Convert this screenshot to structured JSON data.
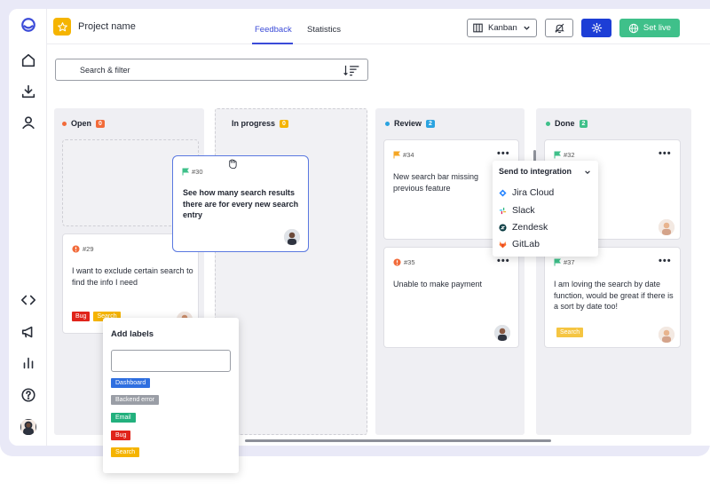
{
  "header": {
    "project_name": "Project name",
    "tabs": [
      {
        "label": "Feedback",
        "active": true
      },
      {
        "label": "Statistics",
        "active": false
      }
    ],
    "view_select": "Kanban",
    "set_live_label": "Set live"
  },
  "search": {
    "placeholder": "Search & filter"
  },
  "columns": [
    {
      "title": "Open",
      "count": "0",
      "dot_color": "#f26b3a",
      "count_color": "#f26b3a"
    },
    {
      "title": "In progress",
      "count": "0",
      "dot_color": "",
      "count_color": "#f5b400"
    },
    {
      "title": "Review",
      "count": "2",
      "dot_color": "#2aa3e0",
      "count_color": "#2aa3e0"
    },
    {
      "title": "Done",
      "count": "2",
      "dot_color": "#3fc08a",
      "count_color": "#3fc08a"
    }
  ],
  "cards": {
    "c29": {
      "id": "#29",
      "text": "I want to exclude certain search to find the info I need",
      "tags": [
        "Bug",
        "Search"
      ]
    },
    "c30": {
      "id": "#30",
      "text": "See how many search results there are for every new search entry"
    },
    "c34": {
      "id": "#34",
      "text": "New search bar missing previous feature"
    },
    "c35": {
      "id": "#35",
      "text": "Unable to make payment"
    },
    "c32": {
      "id": "#32"
    },
    "c37": {
      "id": "#37",
      "text": "I am loving the search by date function, would be great if there is a sort by date too!",
      "tags": [
        "Search"
      ]
    }
  },
  "add_labels": {
    "title": "Add labels",
    "labels": [
      {
        "name": "Dashboard",
        "color": "#2f6fe0"
      },
      {
        "name": "Backend error",
        "color": "#9a9ea6"
      },
      {
        "name": "Email",
        "color": "#22b07d"
      },
      {
        "name": "Bug",
        "color": "#e0241b"
      },
      {
        "name": "Search",
        "color": "#f5b400"
      }
    ]
  },
  "integration": {
    "title": "Send to integration",
    "items": [
      "Jira Cloud",
      "Slack",
      "Zendesk",
      "GitLab"
    ]
  },
  "colors": {
    "accent": "#3b4bd8",
    "primary_button": "#1d3ed6",
    "live": "#3fc08a"
  }
}
